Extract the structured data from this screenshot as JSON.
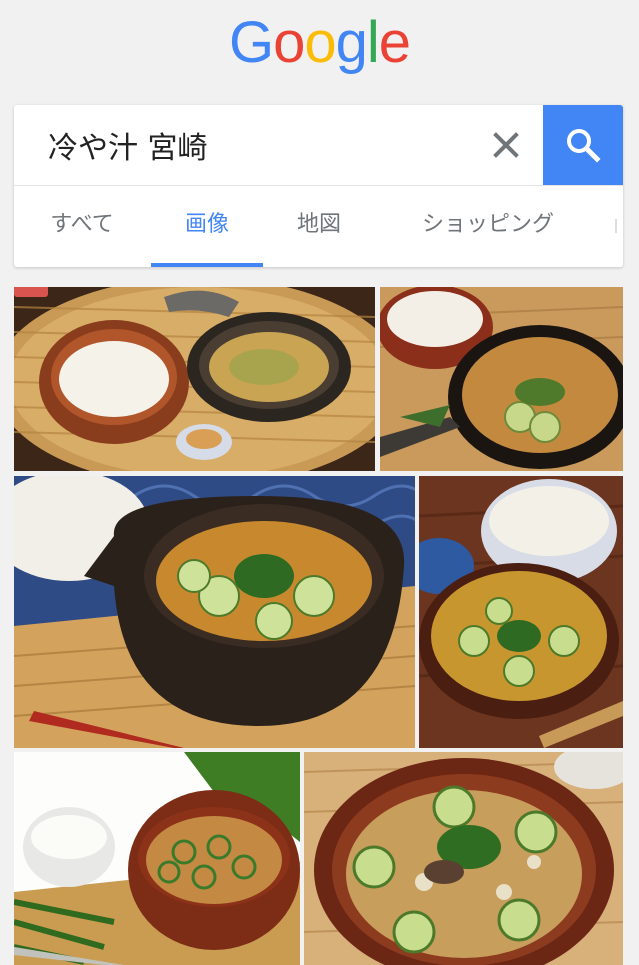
{
  "logo": {
    "letters": [
      {
        "char": "G",
        "color": "#4285f4"
      },
      {
        "char": "o",
        "color": "#ea4335"
      },
      {
        "char": "o",
        "color": "#fbbc05"
      },
      {
        "char": "g",
        "color": "#4285f4"
      },
      {
        "char": "l",
        "color": "#34a853"
      },
      {
        "char": "e",
        "color": "#ea4335"
      }
    ]
  },
  "search": {
    "query": "冷や汁 宮崎",
    "clear_icon": "close-icon",
    "submit_icon": "search-icon"
  },
  "tabs": [
    {
      "label": "すべて",
      "active": false
    },
    {
      "label": "画像",
      "active": true
    },
    {
      "label": "地図",
      "active": false
    },
    {
      "label": "ショッピング",
      "active": false
    }
  ],
  "colors": {
    "accent": "#4285f4",
    "background": "#f1f1f1",
    "tab_inactive": "#70757a"
  },
  "results": {
    "images": [
      {
        "subject": "hiyajiru-set-on-bamboo-tray"
      },
      {
        "subject": "hiyajiru-with-rice-and-fish"
      },
      {
        "subject": "hiyajiru-in-spouted-bowl"
      },
      {
        "subject": "hiyajiru-with-rice-on-wood"
      },
      {
        "subject": "hiyajiru-with-rice-bowl"
      },
      {
        "subject": "hiyajiru-closeup-bowl"
      }
    ]
  }
}
